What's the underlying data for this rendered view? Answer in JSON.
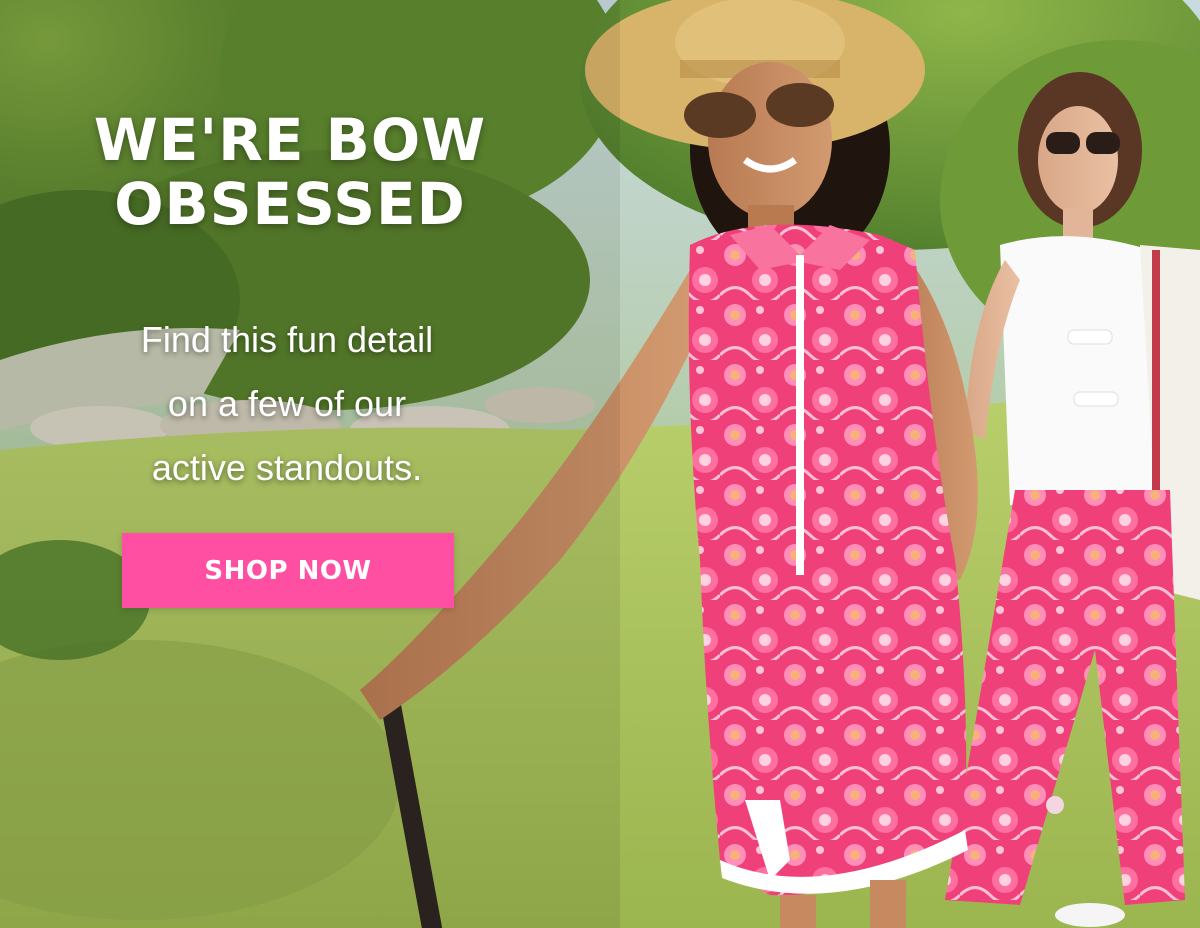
{
  "hero": {
    "headline_line1": "WE'RE BOW",
    "headline_line2": "OBSESSED",
    "subcopy_line1": "Find this fun detail",
    "subcopy_line2": "on a few of our",
    "subcopy_line3": "active standouts.",
    "cta_label": "SHOP NOW"
  },
  "colors": {
    "cta_background": "#ff4fa3",
    "text": "#ffffff",
    "lawn_green": "#a9c35a",
    "dress_pink": "#f0407a"
  }
}
